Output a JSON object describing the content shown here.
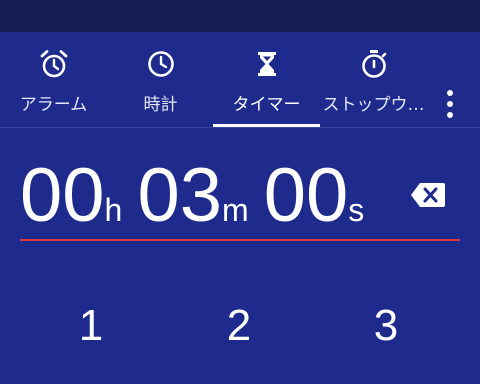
{
  "tabs": [
    {
      "label": "アラーム",
      "icon": "alarm-icon"
    },
    {
      "label": "時計",
      "icon": "clock-icon"
    },
    {
      "label": "タイマー",
      "icon": "hourglass-icon"
    },
    {
      "label": "ストップウ…",
      "icon": "stopwatch-icon"
    }
  ],
  "selected_tab": "タイマー",
  "overflow_menu_icon": "more-vert-icon",
  "timer": {
    "hours": "00",
    "hours_unit": "h",
    "minutes": "03",
    "minutes_unit": "m",
    "seconds": "00",
    "seconds_unit": "s"
  },
  "keypad": [
    "1",
    "2",
    "3"
  ],
  "colors": {
    "background": "#1e2a8c",
    "status_bar": "#151d52",
    "accent_line": "#e0383e",
    "text": "#ffffff"
  }
}
